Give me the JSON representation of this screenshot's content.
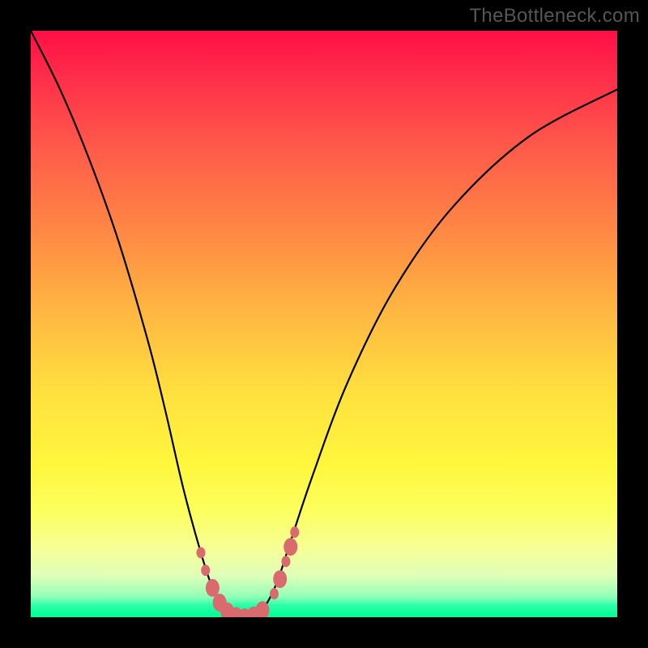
{
  "watermark": "TheBottleneck.com",
  "colors": {
    "background": "#000000",
    "curve": "#000000",
    "markers": "#d96b6f",
    "gradient_top": "#ff0f46",
    "gradient_bottom": "#00ff92"
  },
  "chart_data": {
    "type": "line",
    "title": "",
    "xlabel": "",
    "ylabel": "",
    "xlim": [
      0,
      100
    ],
    "ylim": [
      0,
      100
    ],
    "grid": false,
    "legend": false,
    "series": [
      {
        "name": "bottleneck-curve",
        "x": [
          0,
          5,
          10,
          15,
          20,
          23,
          26,
          29,
          31,
          33,
          35,
          36.5,
          38,
          40,
          42,
          44,
          48,
          54,
          62,
          72,
          85,
          100
        ],
        "values": [
          100,
          90,
          78,
          64,
          47,
          35,
          22,
          11,
          5,
          1.5,
          0.2,
          0,
          0.3,
          2,
          6,
          12,
          24,
          40,
          56,
          70,
          82,
          90
        ]
      }
    ],
    "markers": [
      {
        "x": 29.0,
        "y": 11.0,
        "size": "sm"
      },
      {
        "x": 29.8,
        "y": 8.0,
        "size": "sm"
      },
      {
        "x": 31.0,
        "y": 5.0,
        "size": "lg"
      },
      {
        "x": 32.2,
        "y": 2.5,
        "size": "lg"
      },
      {
        "x": 33.5,
        "y": 1.0,
        "size": "lg"
      },
      {
        "x": 35.0,
        "y": 0.2,
        "size": "lg"
      },
      {
        "x": 36.5,
        "y": 0.0,
        "size": "lg"
      },
      {
        "x": 38.0,
        "y": 0.3,
        "size": "lg"
      },
      {
        "x": 39.5,
        "y": 1.2,
        "size": "lg"
      },
      {
        "x": 41.5,
        "y": 4.0,
        "size": "sm"
      },
      {
        "x": 42.5,
        "y": 6.5,
        "size": "lg"
      },
      {
        "x": 43.5,
        "y": 9.5,
        "size": "sm"
      },
      {
        "x": 44.3,
        "y": 12.0,
        "size": "lg"
      },
      {
        "x": 45.0,
        "y": 14.5,
        "size": "sm"
      }
    ],
    "annotations": []
  }
}
